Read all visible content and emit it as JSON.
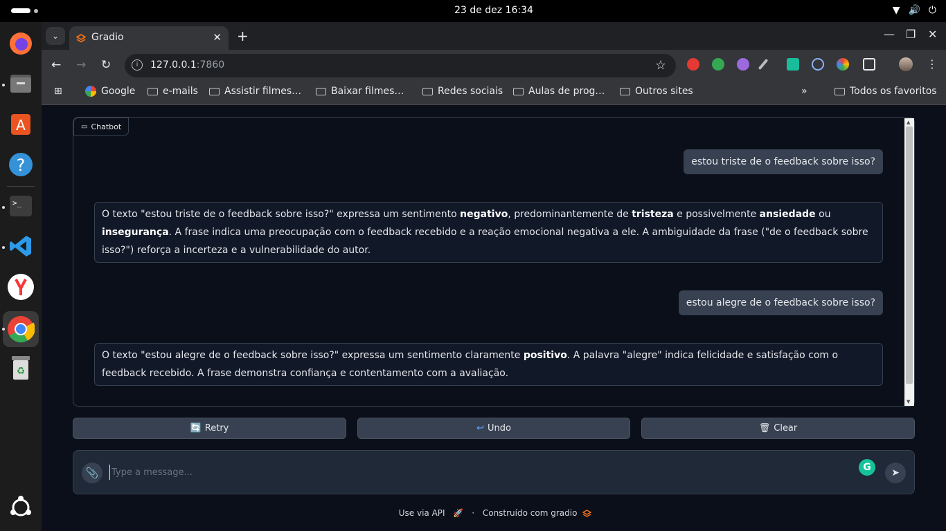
{
  "system": {
    "datetime": "23 de dez  16:34"
  },
  "browser": {
    "tab_title": "Gradio",
    "url_host": "127.0.0.1",
    "url_port": ":7860",
    "bookmarks": [
      {
        "label": "Google",
        "icon": "google-icon"
      },
      {
        "label": "e-mails",
        "icon": "folder-icon"
      },
      {
        "label": "Assistir filmes…",
        "icon": "folder-icon"
      },
      {
        "label": "Baixar filmes…",
        "icon": "folder-icon"
      },
      {
        "label": "Redes sociais",
        "icon": "folder-icon"
      },
      {
        "label": "Aulas de prog…",
        "icon": "folder-icon"
      },
      {
        "label": "Outros sites",
        "icon": "folder-icon"
      }
    ],
    "all_bookmarks": "Todos os favoritos"
  },
  "chatbot": {
    "label": "Chatbot",
    "messages": [
      {
        "role": "user",
        "text": "estou triste de o feedback sobre isso?"
      },
      {
        "role": "bot",
        "text": "O texto \"estou triste de o feedback sobre isso?\" expressa um sentimento negativo, predominantemente de tristeza e possivelmente ansiedade ou insegurança. A frase indica uma preocupação com o feedback recebido e a reação emocional negativa a ele. A ambiguidade da frase (\"de o feedback sobre isso?\") reforça a incerteza e a vulnerabilidade do autor."
      },
      {
        "role": "user",
        "text": "estou alegre de o feedback sobre isso?"
      },
      {
        "role": "bot",
        "text": "O texto \"estou alegre de o feedback sobre isso?\" expressa um sentimento claramente positivo. A palavra \"alegre\" indica felicidade e satisfação com o feedback recebido. A frase demonstra confiança e contentamento com a avaliação."
      }
    ]
  },
  "actions": {
    "retry": "Retry",
    "undo": "Undo",
    "clear": "Clear"
  },
  "composer": {
    "placeholder": "Type a message..."
  },
  "footer": {
    "api": "Use via API",
    "built": "Construído com gradio"
  },
  "colors": {
    "background": "#0b0f19",
    "user_bubble": "#374151",
    "bot_bubble": "#111827",
    "accent": "#f97316"
  }
}
